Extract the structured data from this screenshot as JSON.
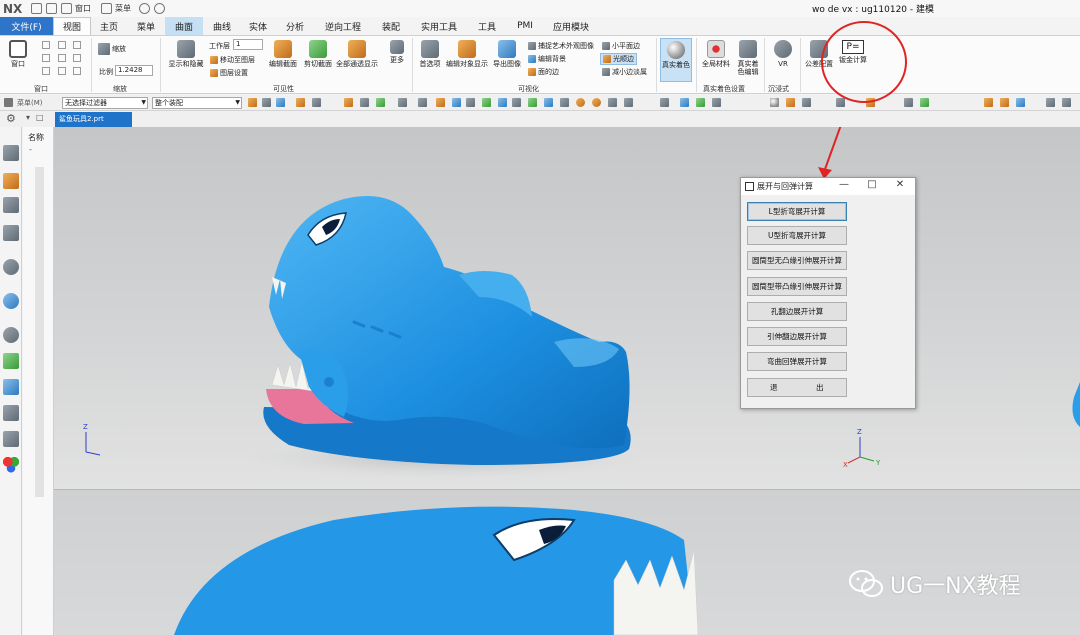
{
  "app": {
    "logo": "NX",
    "title": "wo de vx : ug110120 - 建模",
    "quick_access": [
      "窗口",
      "菜单"
    ]
  },
  "tabs": [
    {
      "label": "文件(F)",
      "state": "file"
    },
    {
      "label": "视图",
      "state": "active"
    },
    {
      "label": "主页",
      "state": ""
    },
    {
      "label": "菜单",
      "state": ""
    },
    {
      "label": "曲面",
      "state": "highlight"
    },
    {
      "label": "曲线",
      "state": ""
    },
    {
      "label": "实体",
      "state": ""
    },
    {
      "label": "分析",
      "state": ""
    },
    {
      "label": "逆向工程",
      "state": ""
    },
    {
      "label": "装配",
      "state": ""
    },
    {
      "label": "实用工具",
      "state": ""
    },
    {
      "label": "工具",
      "state": ""
    },
    {
      "label": "PMI",
      "state": ""
    },
    {
      "label": "应用模块",
      "state": ""
    }
  ],
  "ribbon": {
    "window_btn": "窗口",
    "window_group": "窗口",
    "zoom_btn": "缩放",
    "scale_label": "比例",
    "scale_value": "1.2428",
    "zoom_group": "缩放",
    "show_hide": "显示和隐藏",
    "work_layer_label": "工作层",
    "work_layer_value": "1",
    "move_to_layer": "移动至图层",
    "layer_settings": "图层设置",
    "edit_section": "编辑截面",
    "clip_section": "剪切截面",
    "all_transparent": "全部通透显示",
    "more": "更多",
    "visibility_group": "可见性",
    "preferences": "首选项",
    "edit_object_display": "编辑对象显示",
    "export_image": "导出图像",
    "capture_art": "捕捉艺术外观图像",
    "edit_background": "编辑背景",
    "face_edges": "面的边",
    "small_plane_edges": "小平面边",
    "smooth_edges": "光顺边",
    "reduce_edges": "减小边淡属",
    "visualization_group": "可视化",
    "true_shading": "真实着色",
    "global_material": "全局材料",
    "true_shading_edit": "真实着色编辑",
    "true_shading_group": "真实着色设置",
    "vr": "VR",
    "immersive_group": "沉浸式",
    "tolerance": "公差配置",
    "sheetmetal_calc": "钣金计算"
  },
  "toolbar": {
    "menu": "菜单(M)",
    "filter": "无选择过滤器",
    "assembly": "整个装配"
  },
  "doc": {
    "tab": "鲨鱼玩具2.prt",
    "nav_title": "名称"
  },
  "dialog": {
    "title": "展开与回弹计算",
    "buttons": [
      "L型折弯展开计算",
      "U型折弯展开计算",
      "圆筒型无凸缘引伸展开计算",
      "圆筒型带凸缘引伸展开计算",
      "孔翻边展开计算",
      "引伸翻边展开计算",
      "弯曲回弹展开计算"
    ],
    "exit_left": "退",
    "exit_right": "出"
  },
  "watermark": "UG一NX教程",
  "colors": {
    "accent": "#2e74c9",
    "shark": "#2a9ee8",
    "annotation": "#e02424"
  }
}
